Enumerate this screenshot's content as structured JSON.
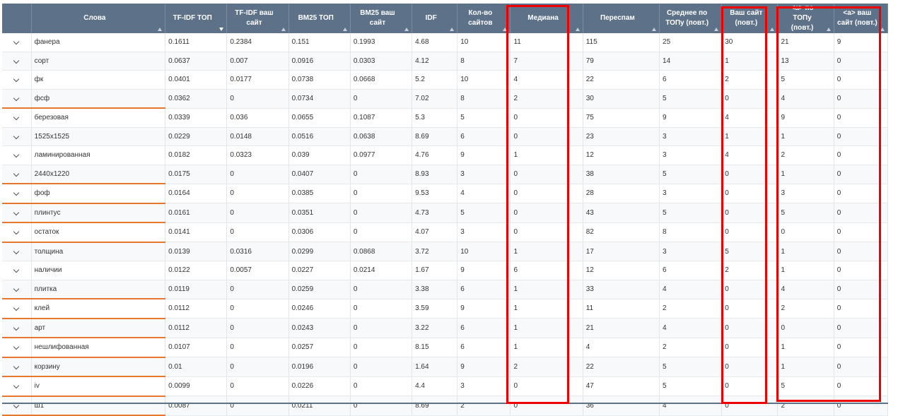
{
  "columns": [
    {
      "key": "expand",
      "label": ""
    },
    {
      "key": "word",
      "label": "Слова"
    },
    {
      "key": "tfidf_top",
      "label": "TF-IDF ТОП"
    },
    {
      "key": "tfidf_site",
      "label": "TF-IDF ваш сайт"
    },
    {
      "key": "bm25_top",
      "label": "BM25 ТОП"
    },
    {
      "key": "bm25_site",
      "label": "BM25 ваш сайт"
    },
    {
      "key": "idf",
      "label": "IDF"
    },
    {
      "key": "sites",
      "label": "Кол-во сайтов"
    },
    {
      "key": "median",
      "label": "Медиана"
    },
    {
      "key": "overspam",
      "label": "Переспам"
    },
    {
      "key": "avg_top",
      "label": "Среднее по ТОПу (повт.)"
    },
    {
      "key": "your_site",
      "label": "Ваш сайт (повт.)"
    },
    {
      "key": "a_top",
      "label": "<a> по ТОПу (повт.)"
    },
    {
      "key": "a_site",
      "label": "<a> ваш сайт (повт.)"
    }
  ],
  "sort_column": "tfidf_top",
  "accent_colors": {
    "header_bg": "#5d7188",
    "highlight": "#ee0000",
    "underline": "#e8772e"
  },
  "rows": [
    {
      "word": "фанера",
      "tfidf_top": "0.1611",
      "tfidf_site": "0.2384",
      "bm25_top": "0.151",
      "bm25_site": "0.1993",
      "idf": "4.68",
      "sites": "10",
      "median": "11",
      "overspam": "115",
      "avg_top": "25",
      "your_site": "30",
      "a_top": "21",
      "a_site": "9",
      "underline": false
    },
    {
      "word": "сорт",
      "tfidf_top": "0.0637",
      "tfidf_site": "0.007",
      "bm25_top": "0.0916",
      "bm25_site": "0.0303",
      "idf": "4.12",
      "sites": "8",
      "median": "7",
      "overspam": "79",
      "avg_top": "14",
      "your_site": "1",
      "a_top": "13",
      "a_site": "0",
      "underline": false
    },
    {
      "word": "фк",
      "tfidf_top": "0.0401",
      "tfidf_site": "0.0177",
      "bm25_top": "0.0738",
      "bm25_site": "0.0668",
      "idf": "5.2",
      "sites": "10",
      "median": "4",
      "overspam": "22",
      "avg_top": "6",
      "your_site": "2",
      "a_top": "5",
      "a_site": "0",
      "underline": false
    },
    {
      "word": "фсф",
      "tfidf_top": "0.0362",
      "tfidf_site": "0",
      "bm25_top": "0.0734",
      "bm25_site": "0",
      "idf": "7.02",
      "sites": "8",
      "median": "2",
      "overspam": "30",
      "avg_top": "5",
      "your_site": "0",
      "a_top": "4",
      "a_site": "0",
      "underline": true
    },
    {
      "word": "березовая",
      "tfidf_top": "0.0339",
      "tfidf_site": "0.036",
      "bm25_top": "0.0655",
      "bm25_site": "0.1087",
      "idf": "5.3",
      "sites": "5",
      "median": "0",
      "overspam": "75",
      "avg_top": "9",
      "your_site": "4",
      "a_top": "9",
      "a_site": "0",
      "underline": false
    },
    {
      "word": "1525x1525",
      "tfidf_top": "0.0229",
      "tfidf_site": "0.0148",
      "bm25_top": "0.0516",
      "bm25_site": "0.0638",
      "idf": "8.69",
      "sites": "6",
      "median": "0",
      "overspam": "23",
      "avg_top": "3",
      "your_site": "1",
      "a_top": "1",
      "a_site": "0",
      "underline": false
    },
    {
      "word": "ламинированная",
      "tfidf_top": "0.0182",
      "tfidf_site": "0.0323",
      "bm25_top": "0.039",
      "bm25_site": "0.0977",
      "idf": "4.76",
      "sites": "9",
      "median": "1",
      "overspam": "12",
      "avg_top": "3",
      "your_site": "4",
      "a_top": "2",
      "a_site": "0",
      "underline": false
    },
    {
      "word": "2440x1220",
      "tfidf_top": "0.0175",
      "tfidf_site": "0",
      "bm25_top": "0.0407",
      "bm25_site": "0",
      "idf": "8.93",
      "sites": "3",
      "median": "0",
      "overspam": "38",
      "avg_top": "5",
      "your_site": "0",
      "a_top": "1",
      "a_site": "0",
      "underline": true
    },
    {
      "word": "фоф",
      "tfidf_top": "0.0164",
      "tfidf_site": "0",
      "bm25_top": "0.0385",
      "bm25_site": "0",
      "idf": "9.53",
      "sites": "4",
      "median": "0",
      "overspam": "28",
      "avg_top": "3",
      "your_site": "0",
      "a_top": "3",
      "a_site": "0",
      "underline": true
    },
    {
      "word": "плинтус",
      "tfidf_top": "0.0161",
      "tfidf_site": "0",
      "bm25_top": "0.0351",
      "bm25_site": "0",
      "idf": "4.73",
      "sites": "5",
      "median": "0",
      "overspam": "43",
      "avg_top": "5",
      "your_site": "0",
      "a_top": "5",
      "a_site": "0",
      "underline": true
    },
    {
      "word": "остаток",
      "tfidf_top": "0.0141",
      "tfidf_site": "0",
      "bm25_top": "0.0306",
      "bm25_site": "0",
      "idf": "4.07",
      "sites": "3",
      "median": "0",
      "overspam": "82",
      "avg_top": "8",
      "your_site": "0",
      "a_top": "0",
      "a_site": "0",
      "underline": true
    },
    {
      "word": "толщина",
      "tfidf_top": "0.0139",
      "tfidf_site": "0.0316",
      "bm25_top": "0.0299",
      "bm25_site": "0.0868",
      "idf": "3.72",
      "sites": "10",
      "median": "1",
      "overspam": "17",
      "avg_top": "3",
      "your_site": "5",
      "a_top": "1",
      "a_site": "0",
      "underline": false
    },
    {
      "word": "наличии",
      "tfidf_top": "0.0122",
      "tfidf_site": "0.0057",
      "bm25_top": "0.0227",
      "bm25_site": "0.0214",
      "idf": "1.67",
      "sites": "9",
      "median": "6",
      "overspam": "12",
      "avg_top": "6",
      "your_site": "2",
      "a_top": "1",
      "a_site": "0",
      "underline": false
    },
    {
      "word": "плитка",
      "tfidf_top": "0.0119",
      "tfidf_site": "0",
      "bm25_top": "0.0259",
      "bm25_site": "0",
      "idf": "3.38",
      "sites": "6",
      "median": "1",
      "overspam": "33",
      "avg_top": "4",
      "your_site": "0",
      "a_top": "4",
      "a_site": "0",
      "underline": true
    },
    {
      "word": "клей",
      "tfidf_top": "0.0112",
      "tfidf_site": "0",
      "bm25_top": "0.0246",
      "bm25_site": "0",
      "idf": "3.59",
      "sites": "9",
      "median": "1",
      "overspam": "11",
      "avg_top": "2",
      "your_site": "0",
      "a_top": "2",
      "a_site": "0",
      "underline": true
    },
    {
      "word": "арт",
      "tfidf_top": "0.0112",
      "tfidf_site": "0",
      "bm25_top": "0.0243",
      "bm25_site": "0",
      "idf": "3.22",
      "sites": "6",
      "median": "1",
      "overspam": "21",
      "avg_top": "4",
      "your_site": "0",
      "a_top": "0",
      "a_site": "0",
      "underline": true
    },
    {
      "word": "нешлифованная",
      "tfidf_top": "0.0107",
      "tfidf_site": "0",
      "bm25_top": "0.0257",
      "bm25_site": "0",
      "idf": "8.15",
      "sites": "6",
      "median": "1",
      "overspam": "4",
      "avg_top": "2",
      "your_site": "0",
      "a_top": "1",
      "a_site": "0",
      "underline": true
    },
    {
      "word": "корзину",
      "tfidf_top": "0.01",
      "tfidf_site": "0",
      "bm25_top": "0.0196",
      "bm25_site": "0",
      "idf": "1.64",
      "sites": "9",
      "median": "2",
      "overspam": "22",
      "avg_top": "5",
      "your_site": "0",
      "a_top": "1",
      "a_site": "0",
      "underline": true
    },
    {
      "word": "iv",
      "tfidf_top": "0.0099",
      "tfidf_site": "0",
      "bm25_top": "0.0226",
      "bm25_site": "0",
      "idf": "4.4",
      "sites": "3",
      "median": "0",
      "overspam": "47",
      "avg_top": "5",
      "your_site": "0",
      "a_top": "5",
      "a_site": "0",
      "underline": true
    },
    {
      "word": "ш1",
      "tfidf_top": "0.0087",
      "tfidf_site": "0",
      "bm25_top": "0.0211",
      "bm25_site": "0",
      "idf": "8.69",
      "sites": "2",
      "median": "0",
      "overspam": "36",
      "avg_top": "4",
      "your_site": "0",
      "a_top": "2",
      "a_site": "0",
      "underline": true
    }
  ]
}
